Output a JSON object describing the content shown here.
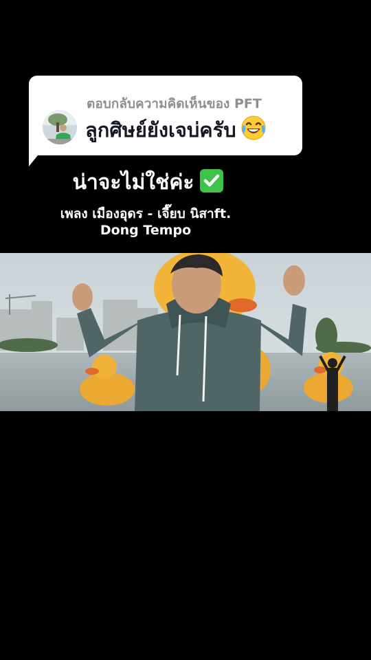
{
  "reply_sticker": {
    "header": "ตอบกลับความคิดเห็นของ PFT",
    "comment": "ลูกศิษย์ยังเจบ่ครับ",
    "comment_emoji": "face-with-tears-of-joy-icon"
  },
  "caption": {
    "text": "น่าจะไม่ใช่ค่ะ",
    "emoji": "check-mark-button-icon"
  },
  "song": {
    "line1": "เพลง เมืองอุดร - เจี๊ยบ นิสาft.",
    "line2": "Dong Tempo"
  },
  "colors": {
    "background": "#000000",
    "sticker_bg": "#ffffff",
    "sticker_header": "#8e8e93",
    "sticker_comment": "#161823",
    "check_green": "#3ec24a"
  }
}
